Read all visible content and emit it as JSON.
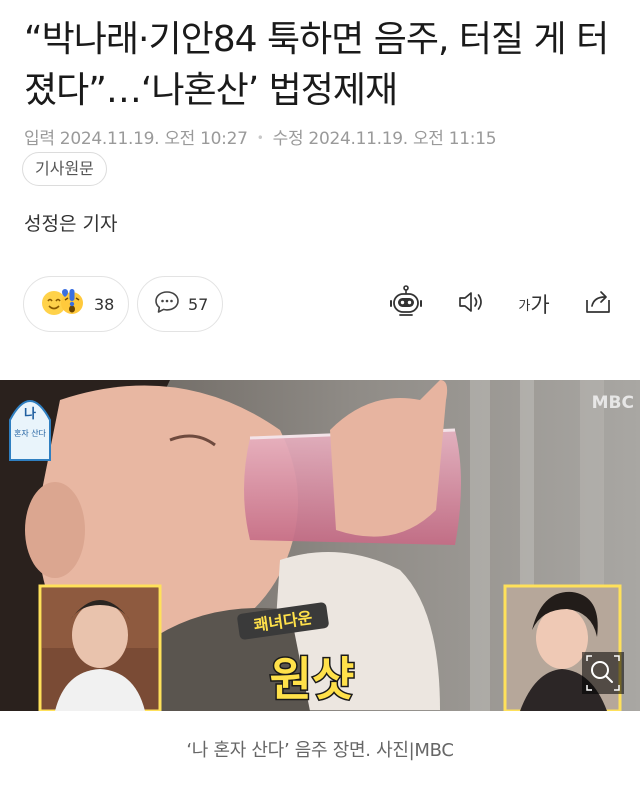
{
  "article": {
    "headline": "“박나래·기안84 툭하면 음주, 터질 게 터졌다”…‘나혼산’ 법정제재",
    "input_label": "입력",
    "input_time": "2024.11.19. 오전 10:27",
    "edit_label": "수정",
    "edit_time": "2024.11.19. 오전 11:15",
    "original_button": "기사원문",
    "reporter": "성정은 기자"
  },
  "actions": {
    "reaction_count": "38",
    "comment_count": "57",
    "font_small": "가",
    "font_large": "가"
  },
  "icons": {
    "reaction": "reaction-emoji-icon",
    "comment": "comment-bubble-icon",
    "summary": "robot-summary-icon",
    "audio": "speaker-icon",
    "share": "share-icon",
    "zoom": "magnifier-zoom-icon"
  },
  "photo": {
    "show_logo_top": "나",
    "show_logo_bottom": "혼자 산다",
    "broadcaster": "MBC",
    "subtitle_small": "쾌녀다운",
    "subtitle_big": "원샷"
  },
  "caption": "‘나 혼자 산다’ 음주 장면. 사진|MBC"
}
